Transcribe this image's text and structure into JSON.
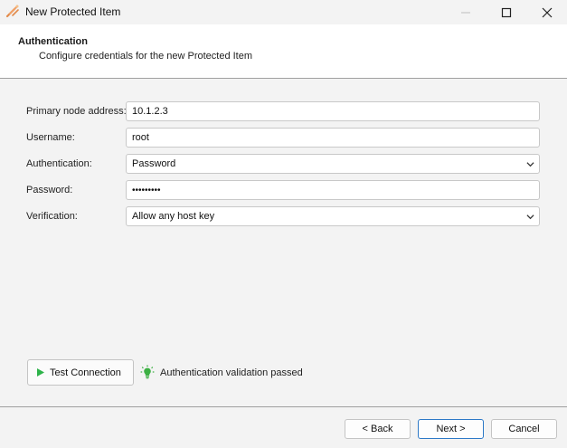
{
  "window": {
    "title": "New Protected Item",
    "icon": "wand-icon"
  },
  "header": {
    "title": "Authentication",
    "subtitle": "Configure credentials for the new Protected Item"
  },
  "form": {
    "primary_node": {
      "label": "Primary node address:",
      "value": "10.1.2.3"
    },
    "username": {
      "label": "Username:",
      "value": "root"
    },
    "authentication": {
      "label": "Authentication:",
      "value": "Password"
    },
    "password": {
      "label": "Password:",
      "value": "•••••••••"
    },
    "verification": {
      "label": "Verification:",
      "value": "Allow any host key"
    }
  },
  "test": {
    "button_label": "Test Connection",
    "status": "Authentication validation passed",
    "status_color": "#3cb043"
  },
  "footer": {
    "back_label": "< Back",
    "next_label": "Next >",
    "cancel_label": "Cancel"
  },
  "colors": {
    "accent": "#2d79c7",
    "play": "#2eb34a"
  }
}
